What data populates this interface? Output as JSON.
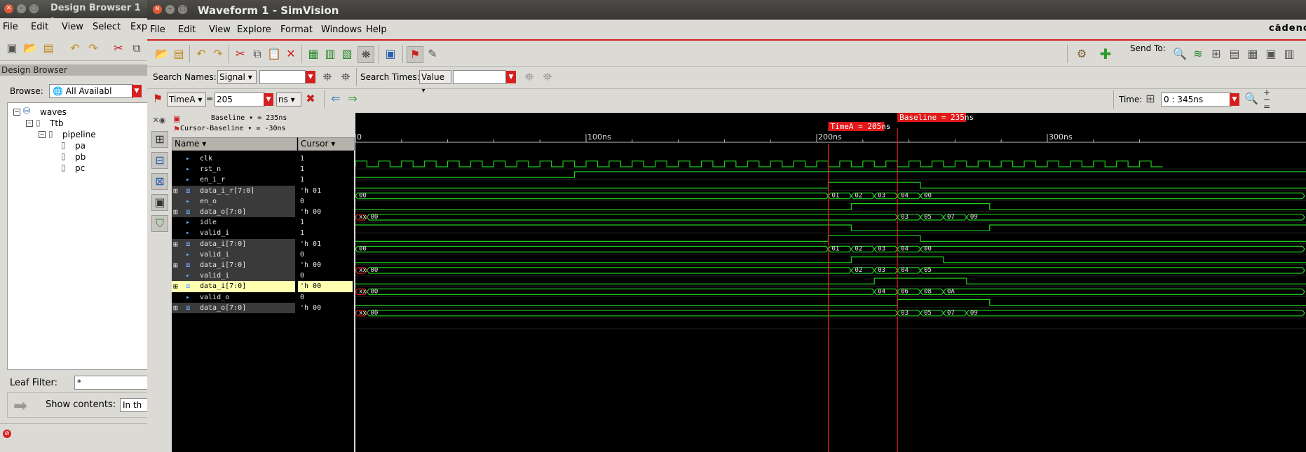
{
  "design_browser": {
    "title": "Design Browser 1 -",
    "menu": [
      "File",
      "Edit",
      "View",
      "Select",
      "Exp"
    ],
    "panel_title": "Design Browser",
    "browse_label": "Browse:",
    "browse_value": "All Availabl",
    "tree": [
      {
        "label": "waves",
        "depth": 0
      },
      {
        "label": "Ttb",
        "depth": 1
      },
      {
        "label": "pipeline",
        "depth": 2
      },
      {
        "label": "pa",
        "depth": 3
      },
      {
        "label": "pb",
        "depth": 3
      },
      {
        "label": "pc",
        "depth": 3
      }
    ],
    "leaf_filter_label": "Leaf Filter:",
    "leaf_filter_value": "*",
    "show_contents_label": "Show contents:",
    "show_contents_value": "In th"
  },
  "main": {
    "title": "Waveform 1 - SimVision",
    "menu": [
      "File",
      "Edit",
      "View",
      "Explore",
      "Format",
      "Windows",
      "Help"
    ],
    "brand": "cādenc",
    "send_to_label": "Send To:",
    "search_names_label": "Search Names:",
    "search_names_type": "Signal",
    "search_times_label": "Search Times:",
    "search_times_type": "Value",
    "cursor_name": "TimeA",
    "cursor_eq": "=",
    "cursor_value": "205",
    "cursor_unit": "ns",
    "time_label": "Time:",
    "time_range": "0 : 345ns"
  },
  "signals_header": {
    "baseline_label": "Baseline ▾ = 235ns",
    "cursor_baseline_label": "Cursor-Baseline ▾ = -30ns",
    "name_col": "Name ▾",
    "cursor_col": "Cursor ▾"
  },
  "signals": [
    {
      "name": "clk",
      "value": "1",
      "expand": false,
      "kind": "clock"
    },
    {
      "name": "rst_n",
      "value": "1",
      "expand": false,
      "kind": "bit"
    },
    {
      "name": "en_i_r",
      "value": "1",
      "expand": false,
      "kind": "bit"
    },
    {
      "name": "data_i_r[7:0]",
      "value": "'h 01",
      "expand": true,
      "kind": "bus"
    },
    {
      "name": "en_o",
      "value": "0",
      "expand": false,
      "kind": "bit"
    },
    {
      "name": "data_o[7:0]",
      "value": "'h 00",
      "expand": true,
      "kind": "bus"
    },
    {
      "name": "idle",
      "value": "1",
      "expand": false,
      "kind": "bit"
    },
    {
      "name": "valid_i",
      "value": "1",
      "expand": false,
      "kind": "bit"
    },
    {
      "name": "data_i[7:0]",
      "value": "'h 01",
      "expand": true,
      "kind": "bus"
    },
    {
      "name": "valid_i",
      "value": "0",
      "expand": false,
      "kind": "bit"
    },
    {
      "name": "data_i[7:0]",
      "value": "'h 00",
      "expand": true,
      "kind": "bus"
    },
    {
      "name": "valid_i",
      "value": "0",
      "expand": false,
      "kind": "bit"
    },
    {
      "name": "data_i[7:0]",
      "value": "'h 00",
      "expand": true,
      "kind": "bus",
      "selected": true
    },
    {
      "name": "valid_o",
      "value": "0",
      "expand": false,
      "kind": "bit"
    },
    {
      "name": "data_o[7:0]",
      "value": "'h 00",
      "expand": true,
      "kind": "bus"
    }
  ],
  "waveform": {
    "time_max_ns": 345,
    "ruler_labels": [
      {
        "t": 0,
        "text": "0"
      },
      {
        "t": 100,
        "text": "100ns"
      },
      {
        "t": 200,
        "text": "200ns"
      },
      {
        "t": 300,
        "text": "300ns"
      }
    ],
    "cursor_a": {
      "t": 205,
      "text": "TimeA = 205ns"
    },
    "baseline": {
      "t": 235,
      "text": "Baseline = 235ns"
    },
    "clock_period_ns": 10,
    "bits": [
      null,
      null,
      {
        "row": 2,
        "edges": [
          [
            0,
            0
          ],
          [
            205,
            1
          ],
          [
            245,
            0
          ]
        ]
      },
      null,
      {
        "row": 4,
        "edges": [
          [
            0,
            0
          ],
          [
            215,
            1
          ],
          [
            275,
            0
          ]
        ]
      },
      null,
      {
        "row": 6,
        "edges": [
          [
            0,
            1
          ],
          [
            215,
            0
          ],
          [
            275,
            1
          ]
        ]
      },
      {
        "row": 7,
        "edges": [
          [
            0,
            0
          ],
          [
            205,
            1
          ],
          [
            245,
            0
          ]
        ]
      },
      null,
      {
        "row": 9,
        "edges": [
          [
            0,
            0
          ],
          [
            215,
            1
          ],
          [
            255,
            0
          ]
        ]
      },
      null,
      {
        "row": 11,
        "edges": [
          [
            0,
            0
          ],
          [
            225,
            1
          ],
          [
            265,
            0
          ]
        ]
      },
      null,
      {
        "row": 13,
        "edges": [
          [
            0,
            0
          ],
          [
            235,
            1
          ],
          [
            275,
            0
          ]
        ]
      }
    ],
    "rst_edges": [
      [
        0,
        0
      ],
      [
        95,
        1
      ]
    ],
    "buses": [
      {
        "row": 3,
        "segs": [
          [
            0,
            "00"
          ],
          [
            205,
            "01"
          ],
          [
            215,
            "02"
          ],
          [
            225,
            "03"
          ],
          [
            235,
            "04"
          ],
          [
            245,
            "00"
          ]
        ]
      },
      {
        "row": 5,
        "segs": [
          [
            0,
            "xx"
          ],
          [
            5,
            "00"
          ],
          [
            235,
            "03"
          ],
          [
            245,
            "05"
          ],
          [
            255,
            "07"
          ],
          [
            265,
            "09"
          ]
        ]
      },
      {
        "row": 8,
        "segs": [
          [
            0,
            "00"
          ],
          [
            205,
            "01"
          ],
          [
            215,
            "02"
          ],
          [
            225,
            "03"
          ],
          [
            235,
            "04"
          ],
          [
            245,
            "00"
          ]
        ]
      },
      {
        "row": 10,
        "segs": [
          [
            0,
            "xx"
          ],
          [
            5,
            "00"
          ],
          [
            215,
            "02"
          ],
          [
            225,
            "03"
          ],
          [
            235,
            "04"
          ],
          [
            245,
            "05"
          ]
        ]
      },
      {
        "row": 12,
        "segs": [
          [
            0,
            "xx"
          ],
          [
            5,
            "00"
          ],
          [
            225,
            "04"
          ],
          [
            235,
            "06"
          ],
          [
            245,
            "08"
          ],
          [
            255,
            "0A"
          ]
        ]
      },
      {
        "row": 14,
        "segs": [
          [
            0,
            "xx"
          ],
          [
            5,
            "00"
          ],
          [
            235,
            "03"
          ],
          [
            245,
            "05"
          ],
          [
            255,
            "07"
          ],
          [
            265,
            "09"
          ]
        ]
      }
    ]
  }
}
